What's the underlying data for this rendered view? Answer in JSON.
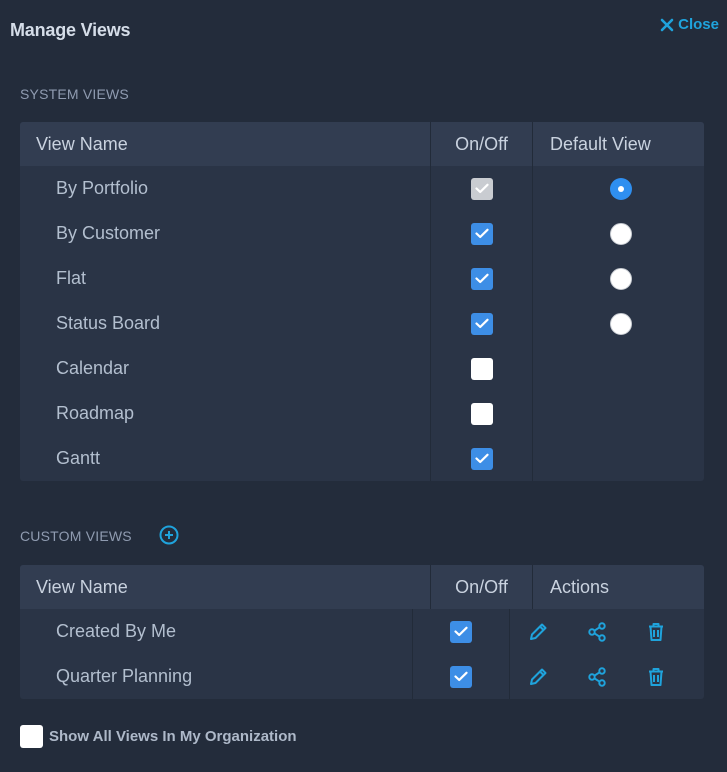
{
  "dialog": {
    "title": "Manage Views",
    "close_label": "Close"
  },
  "system": {
    "label": "SYSTEM VIEWS",
    "headers": {
      "name": "View Name",
      "onoff": "On/Off",
      "default": "Default View"
    },
    "rows": [
      {
        "name": "By Portfolio",
        "checkbox": "disabled-checked",
        "radio": "selected"
      },
      {
        "name": "By Customer",
        "checkbox": "checked",
        "radio": "unselected"
      },
      {
        "name": "Flat",
        "checkbox": "checked",
        "radio": "unselected"
      },
      {
        "name": "Status Board",
        "checkbox": "checked",
        "radio": "unselected"
      },
      {
        "name": "Calendar",
        "checkbox": "unchecked",
        "radio": "none"
      },
      {
        "name": "Roadmap",
        "checkbox": "unchecked",
        "radio": "none"
      },
      {
        "name": "Gantt",
        "checkbox": "checked",
        "radio": "none"
      }
    ]
  },
  "custom": {
    "label": "CUSTOM VIEWS",
    "add_icon": "plus-circle-icon",
    "headers": {
      "name": "View Name",
      "onoff": "On/Off",
      "actions": "Actions"
    },
    "rows": [
      {
        "name": "Created By Me",
        "checkbox": "checked",
        "actions": [
          "pencil-icon",
          "share-icon",
          "trash-icon"
        ]
      },
      {
        "name": "Quarter Planning",
        "checkbox": "checked",
        "actions": [
          "pencil-icon",
          "share-icon",
          "trash-icon"
        ]
      }
    ]
  },
  "footer": {
    "label": "Show All Views In My Organization",
    "checked": false
  },
  "colors": {
    "background": "#232c3b",
    "panel": "#2a3446",
    "header": "#323d51",
    "accent": "#1fa3dc",
    "checkbox": "#3d8ee6"
  }
}
